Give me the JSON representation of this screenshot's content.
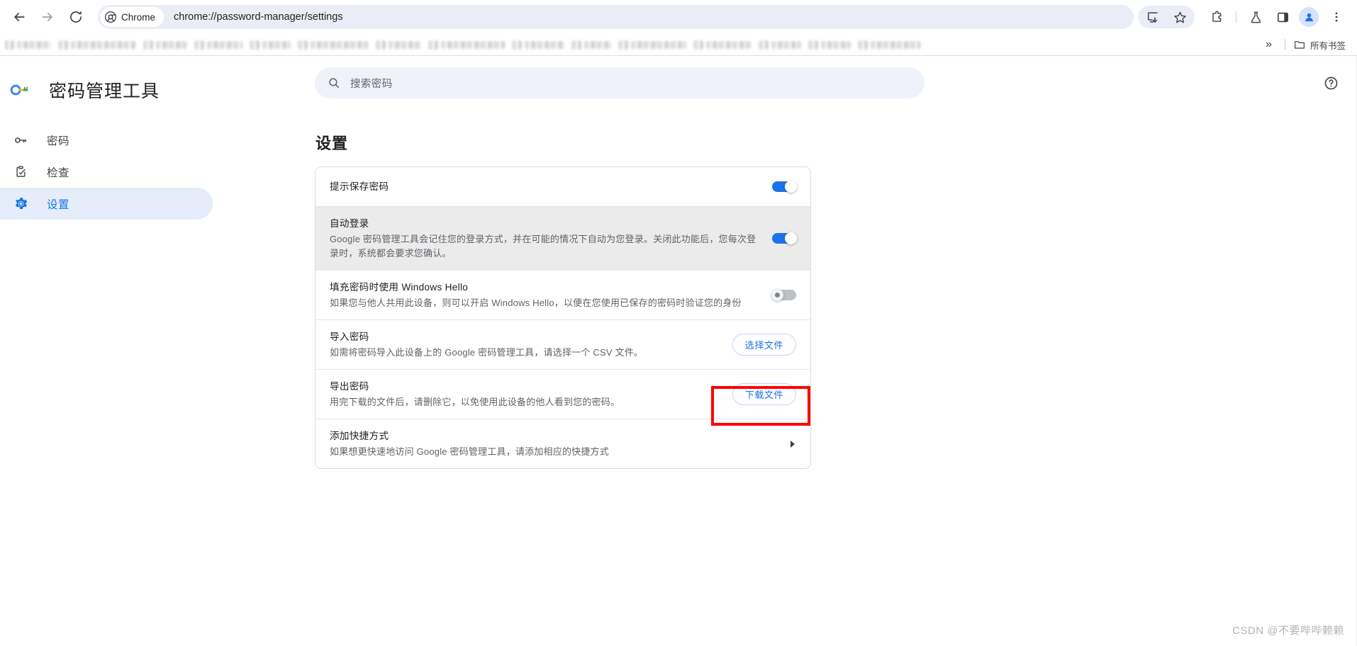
{
  "browser": {
    "back_icon": "back-arrow-icon",
    "forward_icon": "forward-arrow-icon",
    "reload_icon": "reload-icon",
    "chrome_chip_label": "Chrome",
    "url": "chrome://password-manager/settings",
    "actions": [
      {
        "name": "install-app-icon"
      },
      {
        "name": "bookmark-star-icon"
      },
      {
        "name": "extensions-puzzle-icon"
      },
      {
        "name": "experiments-flask-icon"
      },
      {
        "name": "side-panel-icon"
      },
      {
        "name": "profile-avatar-icon"
      },
      {
        "name": "three-dot-menu-icon"
      }
    ]
  },
  "bookmarks": {
    "overflow_label": "»",
    "all_bookmarks_label": "所有书签",
    "blurred_item_widths": [
      48,
      92,
      44,
      50,
      40,
      82,
      46,
      90,
      56,
      38,
      78,
      64,
      42,
      42,
      70
    ]
  },
  "sidebar": {
    "brand_title": "密码管理工具",
    "brand_icon": "google-password-key-icon",
    "items": [
      {
        "label": "密码",
        "icon": "key-icon",
        "selected": false
      },
      {
        "label": "检查",
        "icon": "checkup-clipboard-icon",
        "selected": false
      },
      {
        "label": "设置",
        "icon": "gear-icon",
        "selected": true
      }
    ]
  },
  "search": {
    "placeholder": "搜索密码",
    "icon": "search-icon"
  },
  "help": {
    "icon": "help-circle-icon"
  },
  "main": {
    "page_title": "设置",
    "rows": [
      {
        "title": "提示保存密码",
        "subtitle": "",
        "control": "toggle",
        "toggle_state": "on",
        "highlight": false
      },
      {
        "title": "自动登录",
        "subtitle": "Google 密码管理工具会记住您的登录方式，并在可能的情况下自动为您登录。关闭此功能后，您每次登录时，系统都会要求您确认。",
        "control": "toggle",
        "toggle_state": "on",
        "highlight": true
      },
      {
        "title": "填充密码时使用 Windows Hello",
        "subtitle": "如果您与他人共用此设备，则可以开启 Windows Hello，以便在您使用已保存的密码时验证您的身份",
        "control": "toggle",
        "toggle_state": "off",
        "highlight": false
      },
      {
        "title": "导入密码",
        "subtitle": "如需将密码导入此设备上的 Google 密码管理工具，请选择一个 CSV 文件。",
        "control": "button",
        "button_label": "选择文件",
        "highlight": false
      },
      {
        "title": "导出密码",
        "subtitle": "用完下载的文件后，请删除它，以免使用此设备的他人看到您的密码。",
        "control": "button",
        "button_label": "下载文件",
        "highlight": false,
        "annotated": true
      },
      {
        "title": "添加快捷方式",
        "subtitle": "如果想更快速地访问 Google 密码管理工具，请添加相应的快捷方式",
        "control": "chevron",
        "highlight": false
      }
    ]
  },
  "annotation": {
    "color": "#ff0000"
  },
  "watermark": {
    "text": "CSDN @不要哔哔赖赖"
  },
  "colors": {
    "accent": "#1a73e8",
    "selected_nav_bg": "#e5edfb",
    "omnibox_bg": "#eaedf6",
    "search_bg": "#eff2f9",
    "row_highlight": "#ebebeb",
    "annotation_red": "#ff0000"
  }
}
